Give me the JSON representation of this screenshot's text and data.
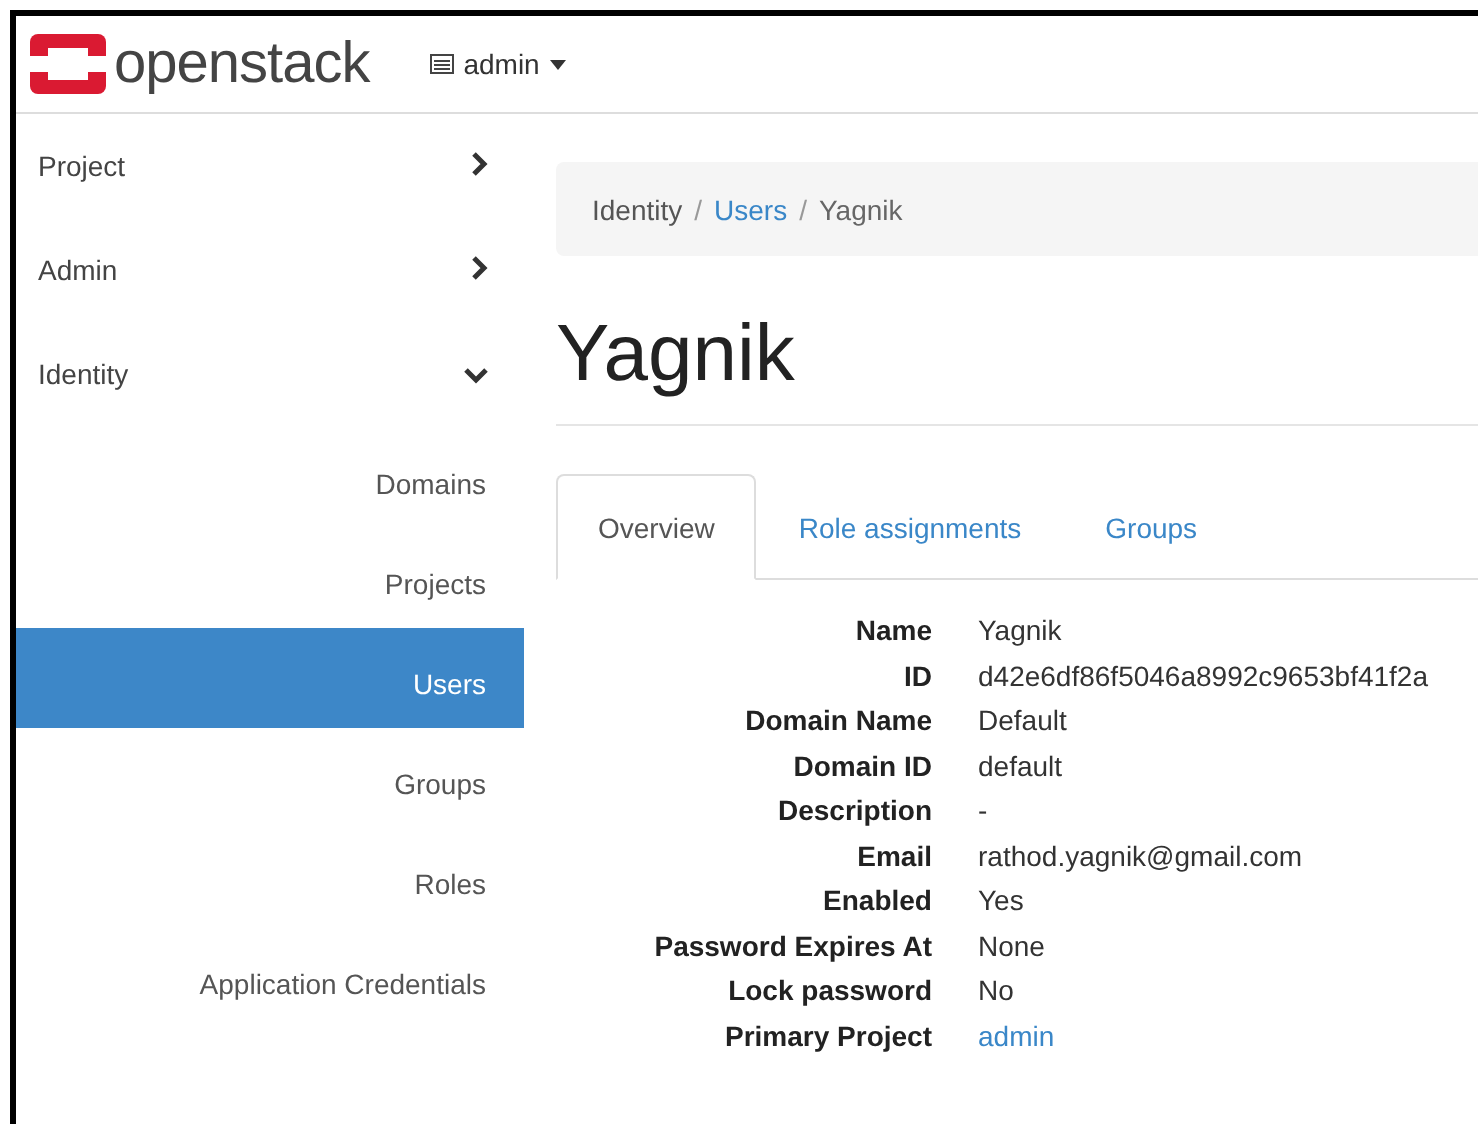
{
  "header": {
    "brand": "openstack",
    "project_menu": "admin"
  },
  "sidebar": {
    "items": [
      {
        "label": "Project",
        "expanded": false
      },
      {
        "label": "Admin",
        "expanded": false
      },
      {
        "label": "Identity",
        "expanded": true,
        "children": [
          {
            "label": "Domains",
            "selected": false
          },
          {
            "label": "Projects",
            "selected": false
          },
          {
            "label": "Users",
            "selected": true
          },
          {
            "label": "Groups",
            "selected": false
          },
          {
            "label": "Roles",
            "selected": false
          },
          {
            "label": "Application Credentials",
            "selected": false
          }
        ]
      }
    ]
  },
  "breadcrumb": [
    {
      "label": "Identity",
      "kind": "text"
    },
    {
      "label": "/",
      "kind": "separator"
    },
    {
      "label": "Users",
      "kind": "link"
    },
    {
      "label": "/",
      "kind": "separator"
    },
    {
      "label": "Yagnik",
      "kind": "current"
    }
  ],
  "page_title": "Yagnik",
  "tabs": [
    {
      "label": "Overview",
      "selected": true
    },
    {
      "label": "Role assignments",
      "selected": false
    },
    {
      "label": "Groups",
      "selected": false
    }
  ],
  "details": [
    {
      "label": "Name",
      "value": "Yagnik",
      "kind": "text"
    },
    {
      "label": "ID",
      "value": "d42e6df86f5046a8992c9653bf41f2a",
      "kind": "text"
    },
    {
      "label": "Domain Name",
      "value": "Default",
      "kind": "text"
    },
    {
      "label": "Domain ID",
      "value": "default",
      "kind": "text"
    },
    {
      "label": "Description",
      "value": "-",
      "kind": "text"
    },
    {
      "label": "Email",
      "value": "rathod.yagnik@gmail.com",
      "kind": "text"
    },
    {
      "label": "Enabled",
      "value": "Yes",
      "kind": "text"
    },
    {
      "label": "Password Expires At",
      "value": "None",
      "kind": "text"
    },
    {
      "label": "Lock password",
      "value": "No",
      "kind": "text"
    },
    {
      "label": "Primary Project",
      "value": "admin",
      "kind": "link"
    }
  ]
}
